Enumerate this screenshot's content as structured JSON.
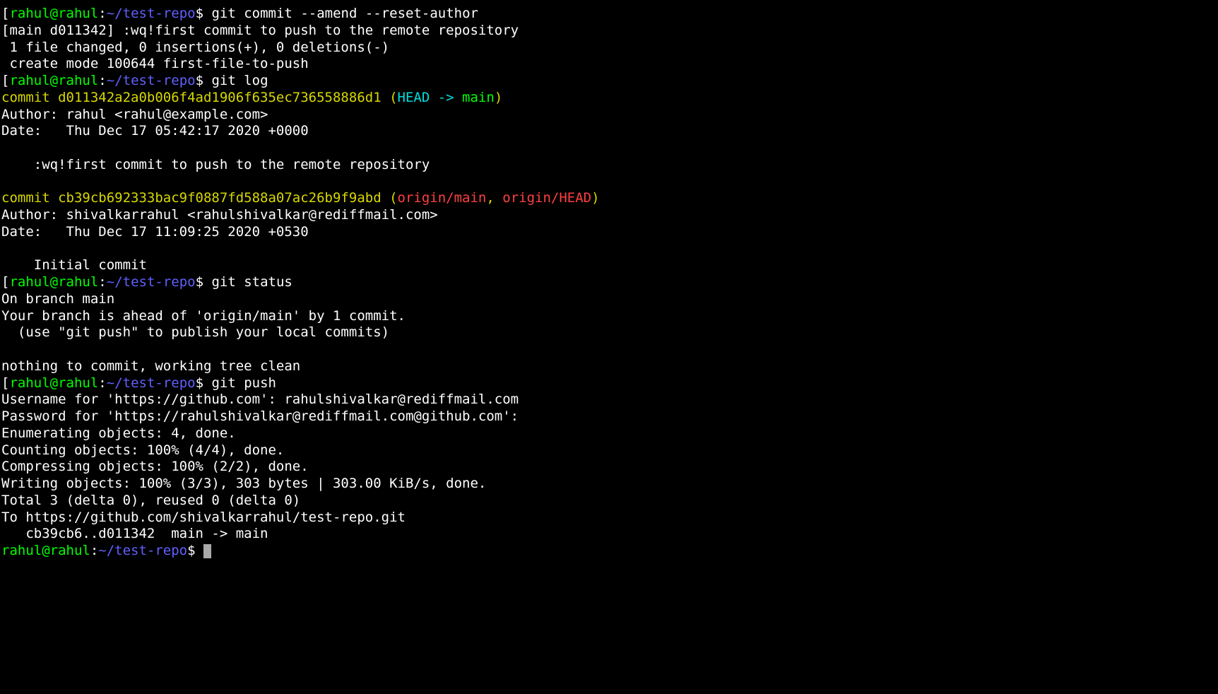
{
  "colors": {
    "green": "#00ff00",
    "blue": "#6060ff",
    "yellow": "#d8d800",
    "cyan": "#00dddd",
    "red": "#ff4040",
    "white": "#ffffff",
    "bg": "#000000"
  },
  "prompt": {
    "userhost": "rahul@rahul",
    "colon": ":",
    "path": "~/test-repo",
    "dollar": "$ "
  },
  "cmd1": "git commit --amend --reset-author",
  "out1_l1": "[main d011342] :wq!first commit to push to the remote repository",
  "out1_l2": " 1 file changed, 0 insertions(+), 0 deletions(-)",
  "out1_l3": " create mode 100644 first-file-to-push",
  "cmd2": "git log",
  "log1_commit": "commit d011342a2a0b006f4ad1906f635ec736558886d1 ",
  "log1_paren_open": "(",
  "log1_head": "HEAD -> ",
  "log1_main": "main",
  "log1_paren_close": ")",
  "log1_author": "Author: rahul <rahul@example.com>",
  "log1_date": "Date:   Thu Dec 17 05:42:17 2020 +0000",
  "log1_msg": "    :wq!first commit to push to the remote repository",
  "log2_commit": "commit cb39cb692333bac9f0887fd588a07ac26b9f9abd ",
  "log2_paren_open": "(",
  "log2_refs": "origin/main",
  "log2_comma": ", ",
  "log2_refs2": "origin/HEAD",
  "log2_paren_close": ")",
  "log2_author": "Author: shivalkarrahul <rahulshivalkar@rediffmail.com>",
  "log2_date": "Date:   Thu Dec 17 11:09:25 2020 +0530",
  "log2_msg": "    Initial commit",
  "cmd3": "git status",
  "status_l1": "On branch main",
  "status_l2": "Your branch is ahead of 'origin/main' by 1 commit.",
  "status_l3": "  (use \"git push\" to publish your local commits)",
  "status_l4": "nothing to commit, working tree clean",
  "cmd4": "git push",
  "push_l1": "Username for 'https://github.com': rahulshivalkar@rediffmail.com",
  "push_l2": "Password for 'https://rahulshivalkar@rediffmail.com@github.com':",
  "push_l3": "Enumerating objects: 4, done.",
  "push_l4": "Counting objects: 100% (4/4), done.",
  "push_l5": "Compressing objects: 100% (2/2), done.",
  "push_l6": "Writing objects: 100% (3/3), 303 bytes | 303.00 KiB/s, done.",
  "push_l7": "Total 3 (delta 0), reused 0 (delta 0)",
  "push_l8": "To https://github.com/shivalkarrahul/test-repo.git",
  "push_l9": "   cb39cb6..d011342  main -> main"
}
